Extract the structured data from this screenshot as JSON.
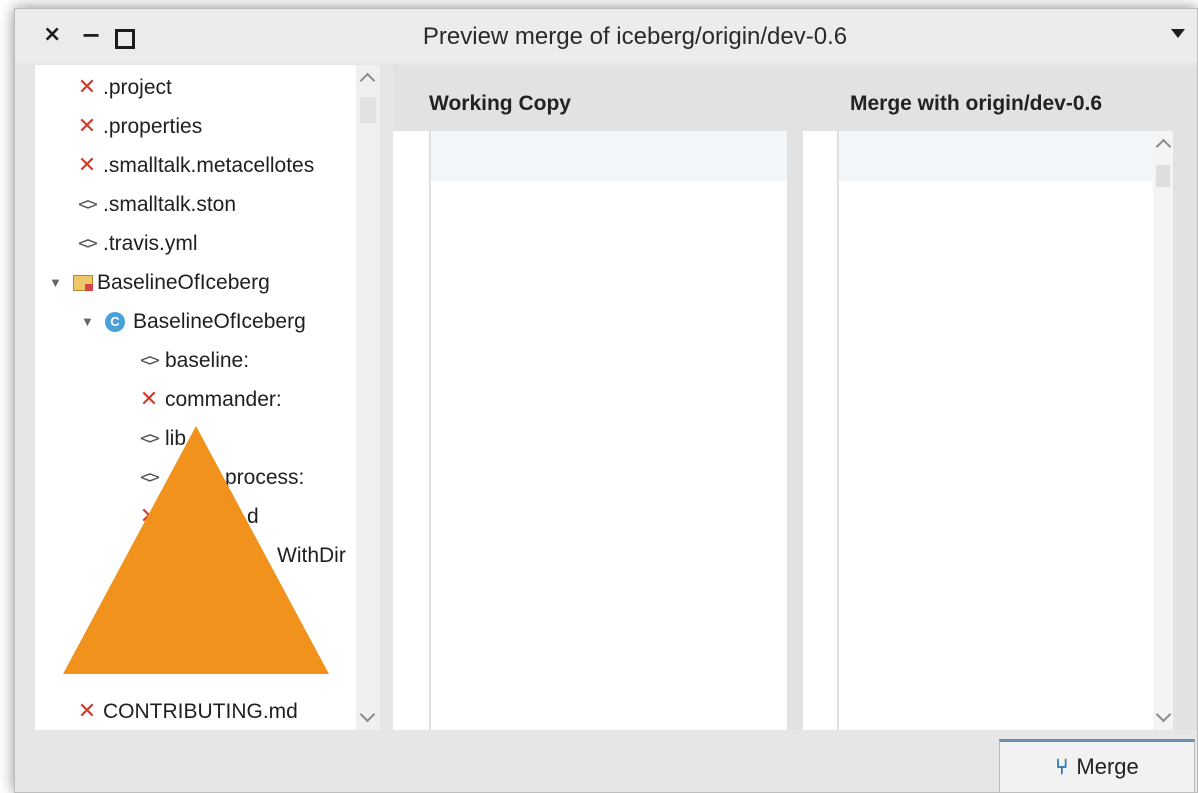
{
  "window": {
    "title": "Preview merge of iceberg/origin/dev-0.6",
    "close_glyph": "×",
    "minimize_glyph": "−"
  },
  "tree": {
    "items": [
      {
        "label": ".project",
        "icon": "remove-icon"
      },
      {
        "label": ".properties",
        "icon": "remove-icon"
      },
      {
        "label": ".smalltalk.metacellotes",
        "icon": "remove-icon"
      },
      {
        "label": ".smalltalk.ston",
        "icon": "code-icon"
      },
      {
        "label": ".travis.yml",
        "icon": "code-icon"
      },
      {
        "label": "BaselineOfIceberg",
        "icon": "package-icon",
        "expanded": true
      },
      {
        "label": "BaselineOfIceberg",
        "icon": "class-icon",
        "expanded": true
      },
      {
        "label": "baseline:",
        "icon": "code-icon"
      },
      {
        "label": "commander:",
        "icon": "remove-icon"
      },
      {
        "label": "lib",
        "icon": "code-icon"
      },
      {
        "label": "process:",
        "icon": "code-icon"
      },
      {
        "label": "d",
        "icon": "remove-icon"
      },
      {
        "label": "WithDir",
        "icon": "remove-icon"
      },
      {
        "label": "CONTRIBUTING.md",
        "icon": "remove-icon"
      }
    ]
  },
  "diff": {
    "left_header": "Working Copy",
    "right_header": "Merge with origin/dev-0.6"
  },
  "merge_button": {
    "label": "Merge",
    "icon": "merge-icon"
  },
  "colors": {
    "remove": "#d23b2b",
    "class": "#4aa0d8",
    "accent": "#2c74b3",
    "overlay": "#f0921c"
  }
}
